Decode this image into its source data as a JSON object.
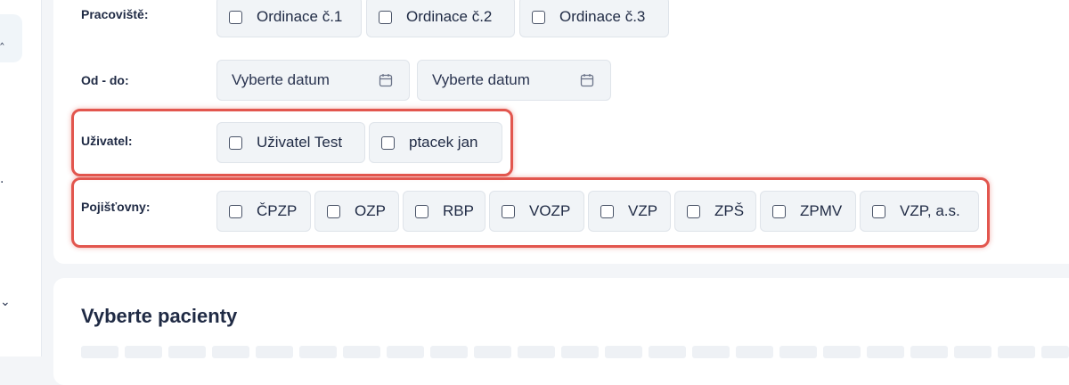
{
  "filters": {
    "workplace": {
      "label": "Pracoviště:",
      "options": [
        "Ordinace č.1",
        "Ordinace č.2",
        "Ordinace č.3"
      ]
    },
    "date_range": {
      "label": "Od - do:",
      "from_placeholder": "Vyberte datum",
      "to_placeholder": "Vyberte datum"
    },
    "user": {
      "label": "Uživatel:",
      "options": [
        "Uživatel Test",
        "ptacek jan"
      ]
    },
    "insurers": {
      "label": "Pojišťovny:",
      "options": [
        "ČPZP",
        "OZP",
        "RBP",
        "VOZP",
        "VZP",
        "ZPŠ",
        "ZPMV",
        "VZP, a.s."
      ]
    }
  },
  "patients": {
    "title": "Vyberte pacienty"
  },
  "colors": {
    "highlight": "#e2564e",
    "text": "#1f2a44",
    "option_bg": "#f1f4f7"
  }
}
